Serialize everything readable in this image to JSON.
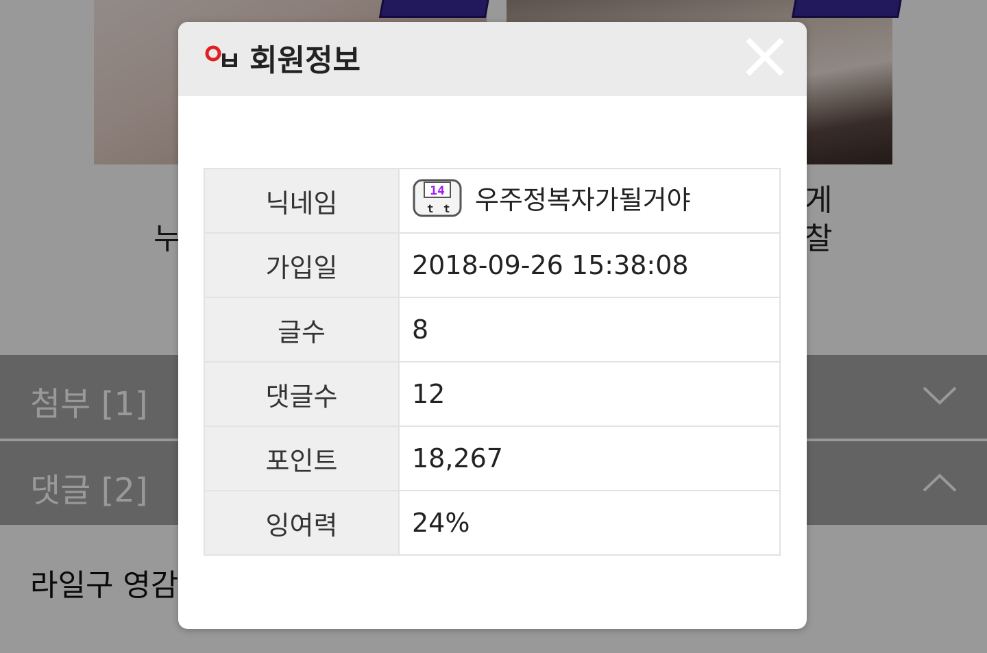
{
  "background": {
    "titles": {
      "left_partial": "누",
      "right_line1_partial": "게",
      "right_line2_partial": "찰"
    },
    "attachments": {
      "label": "첨부 [1]",
      "chevron_icon": "chevron-down-icon"
    },
    "comments": {
      "label": "댓글 [2]",
      "chevron_icon": "chevron-up-icon"
    },
    "first_comment": "라일구 영감"
  },
  "modal": {
    "title": "회원정보",
    "icons": {
      "header": "profile-badge-icon",
      "close": "close-icon",
      "level": "level-14-icon"
    },
    "level_icon_text": "14",
    "rows": [
      {
        "label": "닉네임",
        "value": "우주정복자가될거야"
      },
      {
        "label": "가입일",
        "value": "2018-09-26 15:38:08"
      },
      {
        "label": "글수",
        "value": "8"
      },
      {
        "label": "댓글수",
        "value": "12"
      },
      {
        "label": "포인트",
        "value": "18,267"
      },
      {
        "label": "잉여력",
        "value": "24%"
      }
    ]
  },
  "colors": {
    "overlay": "rgba(0,0,0,0.4)",
    "header_bg": "#ebebeb",
    "label_cell_bg": "#efefef",
    "accent_red": "#e02020",
    "level_purple": "#a020f0"
  }
}
